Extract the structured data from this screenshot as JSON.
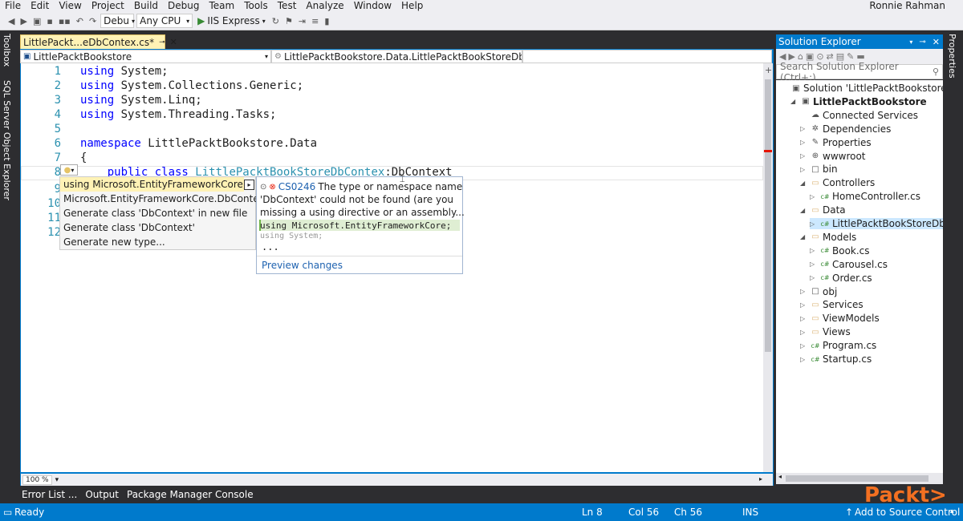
{
  "menu": [
    "File",
    "Edit",
    "View",
    "Project",
    "Build",
    "Debug",
    "Team",
    "Tools",
    "Test",
    "Analyze",
    "Window",
    "Help"
  ],
  "user_name": "Ronnie Rahman",
  "toolbar": {
    "config": "Debu",
    "platform": "Any CPU",
    "run_target": "IIS Express"
  },
  "side_tabs_left": [
    "Toolbox",
    "SQL Server Object Explorer"
  ],
  "side_tab_right": "Properties",
  "doc_tab": {
    "label": "LittlePackt...eDbContex.cs*"
  },
  "nav": {
    "project": "LittlePacktBookstore",
    "type": "LittlePacktBookstore.Data.LittlePacktBookStoreDbConte"
  },
  "code_lines": [
    {
      "n": "1",
      "tokens": [
        {
          "t": "using",
          "c": "kw"
        },
        {
          "t": " System;",
          "c": ""
        }
      ]
    },
    {
      "n": "2",
      "tokens": [
        {
          "t": "using",
          "c": "kw"
        },
        {
          "t": " System.Collections.Generic;",
          "c": ""
        }
      ]
    },
    {
      "n": "3",
      "tokens": [
        {
          "t": "using",
          "c": "kw"
        },
        {
          "t": " System.Linq;",
          "c": ""
        }
      ]
    },
    {
      "n": "4",
      "tokens": [
        {
          "t": "using",
          "c": "kw"
        },
        {
          "t": " System.Threading.Tasks;",
          "c": ""
        }
      ]
    },
    {
      "n": "5",
      "tokens": []
    },
    {
      "n": "6",
      "tokens": [
        {
          "t": "namespace",
          "c": "kw"
        },
        {
          "t": " LittlePacktBookstore.Data",
          "c": ""
        }
      ]
    },
    {
      "n": "7",
      "tokens": [
        {
          "t": "{",
          "c": ""
        }
      ]
    },
    {
      "n": "8",
      "tokens": [
        {
          "t": "    public class ",
          "c": "kw"
        },
        {
          "t": "LittlePacktBookStoreDbContex",
          "c": "ty"
        },
        {
          "t": ":DbContext",
          "c": ""
        }
      ]
    }
  ],
  "hidden_line_numbers": [
    "9",
    "10",
    "11",
    "12"
  ],
  "quick_actions": {
    "items": [
      "using Microsoft.EntityFrameworkCore;",
      "Microsoft.EntityFrameworkCore.DbContext",
      "Generate class 'DbContext' in new file",
      "Generate class 'DbContext'",
      "Generate new type..."
    ]
  },
  "preview": {
    "error_code": "CS0246",
    "error_text_1": "The type or namespace name",
    "error_text_2": "'DbContext' could not be found (are you",
    "error_text_3": "missing a using directive or an assembly...",
    "added_line": "using Microsoft.EntityFrameworkCore;",
    "context_line": "using System;",
    "ellipsis": "...",
    "link": "Preview changes"
  },
  "zoom": "100 %",
  "bottom_tabs": [
    "Error List ...",
    "Output",
    "Package Manager Console"
  ],
  "status": {
    "ready": "Ready",
    "ln": "Ln 8",
    "col": "Col 56",
    "ch": "Ch 56",
    "ins": "INS",
    "source_control": "Add to Source Control"
  },
  "solution_explorer": {
    "title": "Solution Explorer",
    "search_placeholder": "Search Solution Explorer (Ctrl+;)",
    "nodes": [
      {
        "label": "Solution 'LittlePacktBookstore' (1 pr",
        "level": 0,
        "arrow": "",
        "icon": "▣",
        "bold": false
      },
      {
        "label": "LittlePacktBookstore",
        "level": 1,
        "arrow": "◢",
        "icon": "▣",
        "bold": true
      },
      {
        "label": "Connected Services",
        "level": 2,
        "arrow": "",
        "icon": "☁",
        "bold": false
      },
      {
        "label": "Dependencies",
        "level": 2,
        "arrow": "▷",
        "icon": "✲",
        "bold": false
      },
      {
        "label": "Properties",
        "level": 2,
        "arrow": "▷",
        "icon": "✎",
        "bold": false
      },
      {
        "label": "wwwroot",
        "level": 2,
        "arrow": "▷",
        "icon": "⊕",
        "bold": false
      },
      {
        "label": "bin",
        "level": 2,
        "arrow": "▷",
        "icon": "□",
        "bold": false
      },
      {
        "label": "Controllers",
        "level": 2,
        "arrow": "◢",
        "icon": "▭",
        "bold": false
      },
      {
        "label": "HomeController.cs",
        "level": 3,
        "arrow": "▷",
        "icon": "c#",
        "bold": false
      },
      {
        "label": "Data",
        "level": 2,
        "arrow": "◢",
        "icon": "▭",
        "bold": false
      },
      {
        "label": "LittlePacktBookStoreDbConte",
        "level": 3,
        "arrow": "▷",
        "icon": "c#",
        "bold": false,
        "selected": true
      },
      {
        "label": "Models",
        "level": 2,
        "arrow": "◢",
        "icon": "▭",
        "bold": false
      },
      {
        "label": "Book.cs",
        "level": 3,
        "arrow": "▷",
        "icon": "c#",
        "bold": false
      },
      {
        "label": "Carousel.cs",
        "level": 3,
        "arrow": "▷",
        "icon": "c#",
        "bold": false
      },
      {
        "label": "Order.cs",
        "level": 3,
        "arrow": "▷",
        "icon": "c#",
        "bold": false
      },
      {
        "label": "obj",
        "level": 2,
        "arrow": "▷",
        "icon": "□",
        "bold": false
      },
      {
        "label": "Services",
        "level": 2,
        "arrow": "▷",
        "icon": "▭",
        "bold": false
      },
      {
        "label": "ViewModels",
        "level": 2,
        "arrow": "▷",
        "icon": "▭",
        "bold": false
      },
      {
        "label": "Views",
        "level": 2,
        "arrow": "▷",
        "icon": "▭",
        "bold": false
      },
      {
        "label": "Program.cs",
        "level": 2,
        "arrow": "▷",
        "icon": "c#",
        "bold": false
      },
      {
        "label": "Startup.cs",
        "level": 2,
        "arrow": "▷",
        "icon": "c#",
        "bold": false
      }
    ]
  },
  "watermark": "Packt>",
  "colors": {
    "accent": "#007acc",
    "keyword": "#0000ff",
    "type": "#2b91af",
    "highlight": "#fff2b5",
    "brand": "#f37021"
  }
}
